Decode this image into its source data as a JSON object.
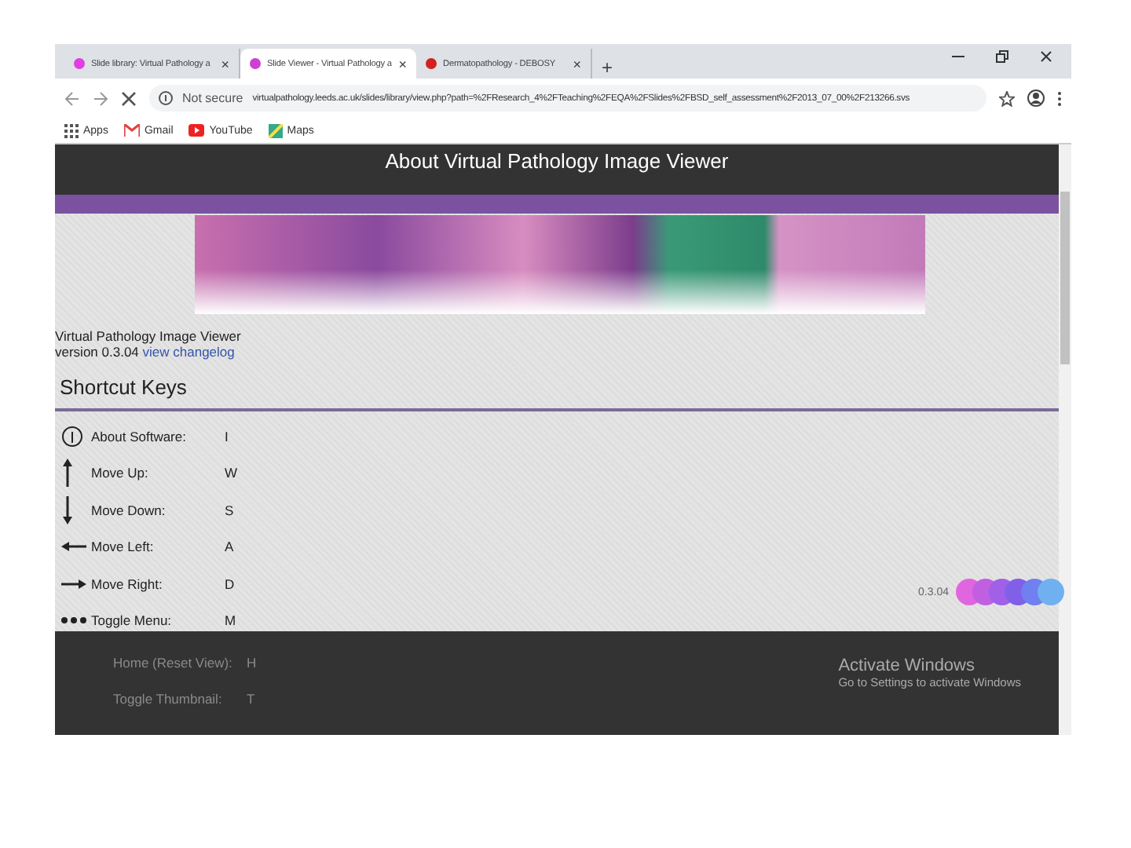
{
  "tabs": [
    {
      "title": "Slide library: Virtual Pathology a",
      "selected": false,
      "color": "#e040e0",
      "close": "×"
    },
    {
      "title": "Slide Viewer - Virtual Pathology a",
      "selected": true,
      "color": "#d040d0",
      "close": "×"
    },
    {
      "title": "Dermatopathology - DEBOSY",
      "selected": false,
      "color": "#d32020",
      "close": "×"
    }
  ],
  "new_tab": "+",
  "address_bar": {
    "security": "Not secure",
    "url": "virtualpathology.leeds.ac.uk/slides/library/view.php?path=%2FResearch_4%2FTeaching%2FEQA%2FSlides%2FBSD_self_assessment%2F2013_07_00%2F213266.svs"
  },
  "bookmarks": [
    {
      "kind": "grid",
      "label": "Apps"
    },
    {
      "kind": "mail",
      "label": "Gmail"
    },
    {
      "kind": "video",
      "label": "YouTube"
    },
    {
      "kind": "map",
      "label": "Maps"
    }
  ],
  "page": {
    "header": "About Virtual Pathology Image Viewer",
    "app_name": "Virtual Pathology Image Viewer",
    "version": "version 0.3.04",
    "changelog_link": "view changelog",
    "section_title": "Shortcut Keys",
    "shortcuts": [
      {
        "kind": "info",
        "action": "About Software:",
        "key": "I"
      },
      {
        "kind": "up",
        "action": "Move Up:",
        "key": "W"
      },
      {
        "kind": "down",
        "action": "Move Down:",
        "key": "S"
      },
      {
        "kind": "left",
        "action": "Move Left:",
        "key": "A"
      },
      {
        "kind": "right",
        "action": "Move Right:",
        "key": "D"
      },
      {
        "kind": "dots",
        "action": "Toggle Menu:",
        "key": "M"
      }
    ],
    "viewer_version": "0.3.04"
  },
  "bottom_panel": {
    "shortcuts": [
      {
        "action": "Home (Reset View):",
        "key": "H"
      },
      {
        "action": "Toggle Thumbnail:",
        "key": "T"
      }
    ],
    "activation_title": "Activate Windows",
    "activation_text": "Go to Settings to activate Windows"
  }
}
